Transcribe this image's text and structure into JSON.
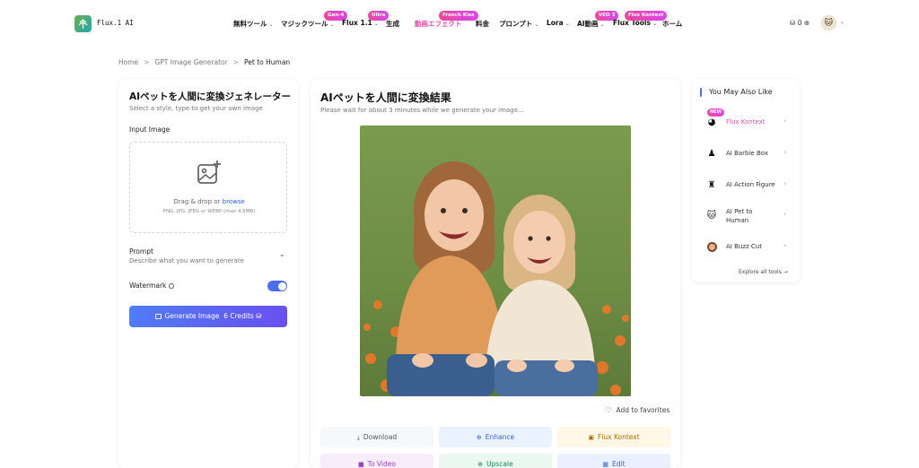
{
  "header": {
    "logo_text": "Flux.1 AI",
    "nav": [
      {
        "label": "無料ツール",
        "chevron": true
      },
      {
        "label": "マジックツール",
        "chevron": true,
        "badge": "Gen-4"
      },
      {
        "label": "Flux 1.1",
        "chevron": true,
        "badge": "Ultra"
      },
      {
        "label": "生成",
        "chevron": false
      },
      {
        "label": "動画エフェクト",
        "chevron": false,
        "badge": "French Kiss",
        "highlight": true
      },
      {
        "label": "料金",
        "chevron": false
      },
      {
        "label": "プロンプト",
        "chevron": true
      },
      {
        "label": "Lora",
        "chevron": true
      },
      {
        "label": "AI動画",
        "chevron": true,
        "badge": "VEO 3"
      },
      {
        "label": "Flux Tools",
        "chevron": true,
        "badge": "Flux Kontext"
      },
      {
        "label": "ホーム",
        "chevron": false
      }
    ],
    "credits": "0",
    "badge_color": "#e94ca8"
  },
  "breadcrumb": {
    "items": [
      "Home",
      "GPT Image Generator",
      "Pet to Human"
    ]
  },
  "left_panel": {
    "title": "AIペットを人間に変換ジェネレーター",
    "subtitle": "Select a style, type to get your own image",
    "input_label": "Input Image",
    "dropzone_text": "Drag & drop or ",
    "dropzone_link": "browse",
    "dropzone_hint": "PNG, JPG, JPEG or WEBP (max 4.5MB)",
    "prompt_label": "Prompt",
    "prompt_sub": "Describe what you want to generate",
    "watermark_label": "Watermark",
    "watermark_on": true,
    "generate_label": "Generate Image",
    "generate_credits": "6 Credits",
    "accent": "#4f6cf7"
  },
  "result_panel": {
    "title": "AIペットを人間に変換結果",
    "subtitle": "Please wait for about 3 minutes while we generate your image...",
    "favorites_label": "Add to favorites",
    "actions": [
      {
        "label": "Download",
        "icon": "download-icon",
        "bg": "#f7f8fa",
        "color": "#555"
      },
      {
        "label": "Enhance",
        "icon": "zoom-icon",
        "bg": "#eaf2ff",
        "color": "#3b63d6"
      },
      {
        "label": "Flux Kontext",
        "icon": "image-icon",
        "bg": "#fff8e6",
        "color": "#b26a00"
      },
      {
        "label": "To Video",
        "icon": "video-icon",
        "bg": "#f7edfb",
        "color": "#9b3fc4"
      },
      {
        "label": "Upscale",
        "icon": "zoom-icon",
        "bg": "#eaf8f1",
        "color": "#13885a"
      },
      {
        "label": "Edit",
        "icon": "edit-icon",
        "bg": "#eaf0fe",
        "color": "#3b63d6"
      }
    ]
  },
  "right_panel": {
    "title": "You May Also Like",
    "items": [
      {
        "label": "Flux Kontext",
        "badge": "NEW",
        "highlight": true,
        "icon": "kontext-icon"
      },
      {
        "label": "AI Barbie Box",
        "icon": "barbie-icon"
      },
      {
        "label": "AI Action Figure",
        "icon": "figure-icon"
      },
      {
        "label": "AI Pet to\nHuman",
        "icon": "cat-icon"
      },
      {
        "label": "AI Buzz Cut",
        "icon": "haircut-icon"
      }
    ],
    "explore_label": "Explore all tools"
  }
}
